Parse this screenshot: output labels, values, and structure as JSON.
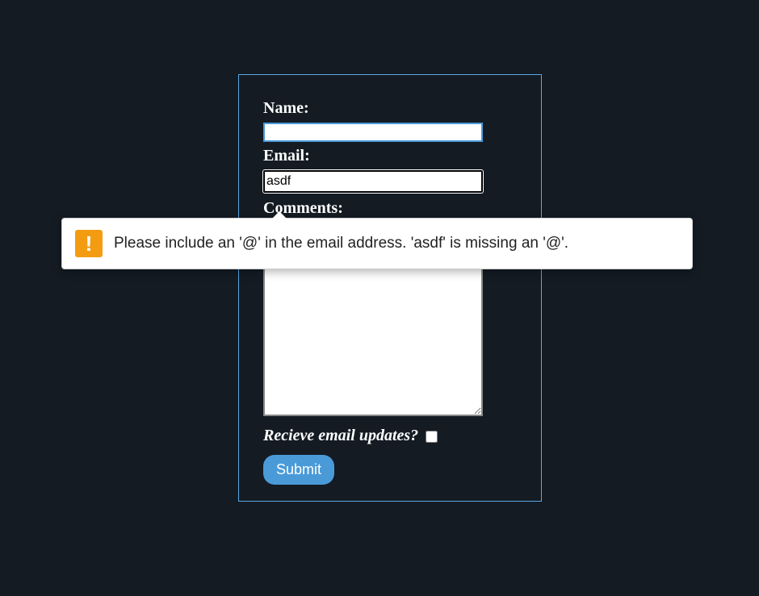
{
  "form": {
    "name": {
      "label": "Name:",
      "value": ""
    },
    "email": {
      "label": "Email:",
      "value": "asdf"
    },
    "comments": {
      "label": "Comments:",
      "value": ""
    },
    "updates": {
      "label": "Recieve email updates?",
      "checked": false
    },
    "submit_label": "Submit"
  },
  "validation": {
    "message": "Please include an '@' in the email address. 'asdf' is missing an '@'."
  }
}
